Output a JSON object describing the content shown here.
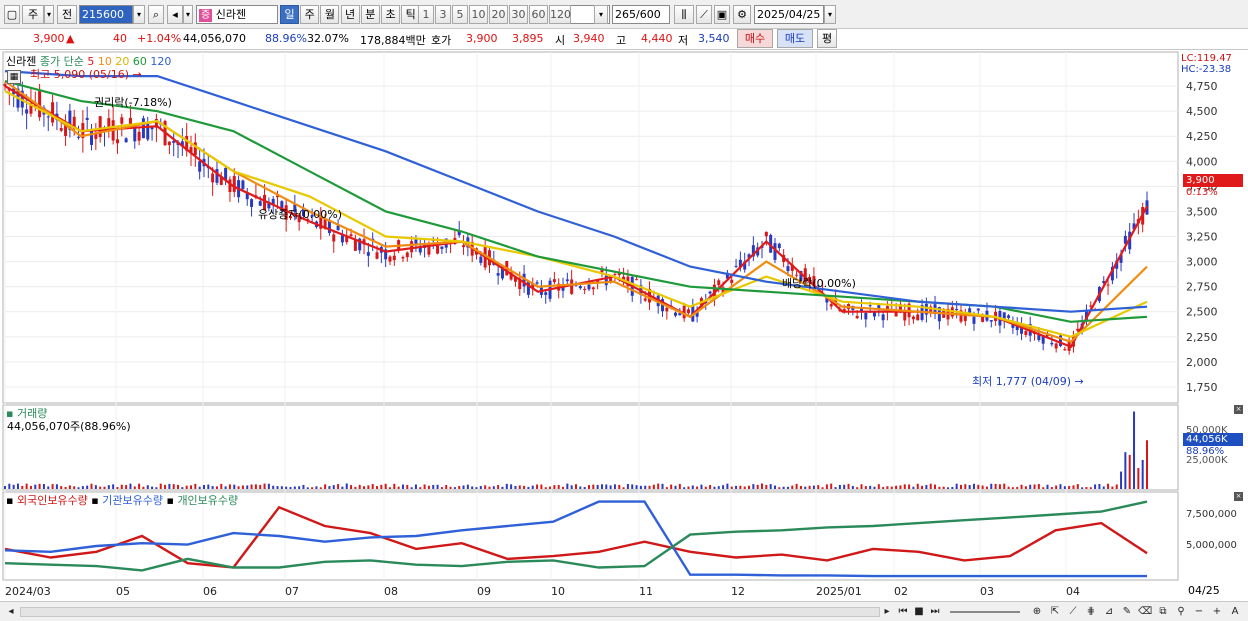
{
  "toolbar": {
    "period_primary": "주",
    "price_type": "전",
    "code": "215600",
    "stock_badge": "증",
    "stock_name": "신라젠",
    "tabs": [
      "일",
      "주",
      "월",
      "년",
      "분",
      "초",
      "틱"
    ],
    "active_tab": "일",
    "intervals": [
      "1",
      "3",
      "5",
      "10",
      "20",
      "30",
      "60",
      "120"
    ],
    "count": "265",
    "count_max": "/600",
    "date": "2025/04/25"
  },
  "quote": {
    "price": "3,900",
    "arrow": "▲",
    "change": "40",
    "change_pct": "+1.04%",
    "volume": "44,056,070",
    "volume_pct": "88.96%",
    "turnover": "32.07%",
    "amount": "178,884백만",
    "hoga_label": "호가",
    "ask": "3,900",
    "bid": "3,895",
    "open_label": "시",
    "open": "3,940",
    "high_label": "고",
    "high": "4,440",
    "low_label": "저",
    "low": "3,540",
    "buy_label": "매수",
    "sell_label": "매도",
    "avg_label": "평"
  },
  "price_panel": {
    "legend_name": "신라젠",
    "legend_ma_prefix": "종가 단순",
    "ma_periods": [
      {
        "period": "5",
        "color": "#e01a1a"
      },
      {
        "period": "10",
        "color": "#f08c10"
      },
      {
        "period": "20",
        "color": "#e8c800"
      },
      {
        "period": "60",
        "color": "#1f9a3a"
      },
      {
        "period": "120",
        "color": "#2f60d8"
      }
    ],
    "high_marker": "최고 5,090 (05/16)",
    "low_marker": "최저 1,777 (04/09)",
    "events": [
      "권리락(-7.18%)",
      "유상증자(0.00%)",
      "배당락(0.00%)"
    ],
    "lc": "LC:119.47",
    "hc": "HC:-23.38",
    "last_price_tag": "3,900",
    "last_pct_tag": "0.13%"
  },
  "volume_panel": {
    "title": "거래량",
    "value": "44,056,070주(88.96%)",
    "tag_value": "44,056K",
    "tag_pct": "88.96%",
    "axis": [
      "50,000K",
      "25,000K"
    ]
  },
  "holdings_panel": {
    "legend": [
      {
        "label": "외국인보유수량",
        "color": "#d01818"
      },
      {
        "label": "기관보유수량",
        "color": "#2f60d8"
      },
      {
        "label": "개인보유수량",
        "color": "#2a8a5a"
      }
    ],
    "axis": [
      "7,500,000",
      "5,000,000"
    ]
  },
  "time_axis": [
    "2024/03",
    "05",
    "06",
    "07",
    "08",
    "09",
    "10",
    "11",
    "12",
    "2025/01",
    "02",
    "03",
    "04"
  ],
  "time_axis_end": "04/25",
  "chart_data": [
    {
      "type": "line",
      "title": "신라젠",
      "ylim": [
        1600,
        5090
      ],
      "y_ticks": [
        4750,
        4500,
        4250,
        4000,
        3750,
        3500,
        3250,
        3000,
        2750,
        2500,
        2250,
        2000,
        1750
      ],
      "x": [
        "2024/03",
        "05",
        "06",
        "07",
        "08",
        "09",
        "10",
        "11",
        "12",
        "2025/01",
        "02",
        "03",
        "04",
        "04/25"
      ],
      "series": [
        {
          "name": "5",
          "values": [
            4750,
            4300,
            4350,
            3750,
            3400,
            3100,
            3200,
            2700,
            2850,
            2450,
            3200,
            2500,
            2500,
            2450,
            2150,
            3550
          ]
        },
        {
          "name": "10",
          "values": [
            4800,
            4250,
            4400,
            3900,
            3500,
            3150,
            3200,
            2750,
            2800,
            2450,
            3000,
            2550,
            2500,
            2450,
            2200,
            2950
          ]
        },
        {
          "name": "20",
          "values": [
            4700,
            4300,
            4400,
            3900,
            3650,
            3250,
            3200,
            3050,
            2850,
            2550,
            2850,
            2600,
            2550,
            2450,
            2250,
            2600
          ]
        },
        {
          "name": "60",
          "values": [
            4800,
            4600,
            4500,
            4300,
            3900,
            3500,
            3300,
            3050,
            2900,
            2750,
            2700,
            2650,
            2600,
            2550,
            2400,
            2450
          ]
        },
        {
          "name": "120",
          "values": [
            4900,
            4850,
            4850,
            4600,
            4350,
            4100,
            3800,
            3500,
            3250,
            2950,
            2800,
            2700,
            2600,
            2550,
            2500,
            2550
          ]
        }
      ]
    },
    {
      "type": "bar",
      "title": "거래량",
      "ylim": [
        0,
        75000
      ],
      "last_value": 44056
    },
    {
      "type": "line",
      "ylim": [
        2800000,
        8800000
      ],
      "series": [
        {
          "name": "외국인보유수량",
          "values": [
            4900000,
            4300000,
            4700000,
            5800000,
            3900000,
            3600000,
            7800000,
            6500000,
            6000000,
            4900000,
            5300000,
            4200000,
            4400000,
            4700000,
            5400000,
            4700000,
            4300000,
            4500000,
            4100000,
            4900000,
            4700000,
            4100000,
            4400000,
            6200000,
            6700000,
            4600000
          ]
        },
        {
          "name": "기관보유수량",
          "values": [
            4800000,
            4700000,
            5100000,
            5300000,
            5200000,
            6000000,
            5800000,
            5400000,
            5700000,
            5800000,
            6200000,
            6500000,
            6800000,
            8200000,
            8200000,
            3100000,
            3100000,
            3050000,
            3050000,
            3000000,
            3000000,
            3000000,
            3000000,
            3000000,
            3000000,
            3000000
          ]
        },
        {
          "name": "개인보유수량",
          "values": [
            3900000,
            3800000,
            3700000,
            3400000,
            4200000,
            3600000,
            3600000,
            4000000,
            4100000,
            3800000,
            3700000,
            4000000,
            4100000,
            3600000,
            3700000,
            5900000,
            6100000,
            6200000,
            6400000,
            6500000,
            6700000,
            6900000,
            7100000,
            7300000,
            7500000,
            8200000
          ]
        }
      ]
    }
  ]
}
